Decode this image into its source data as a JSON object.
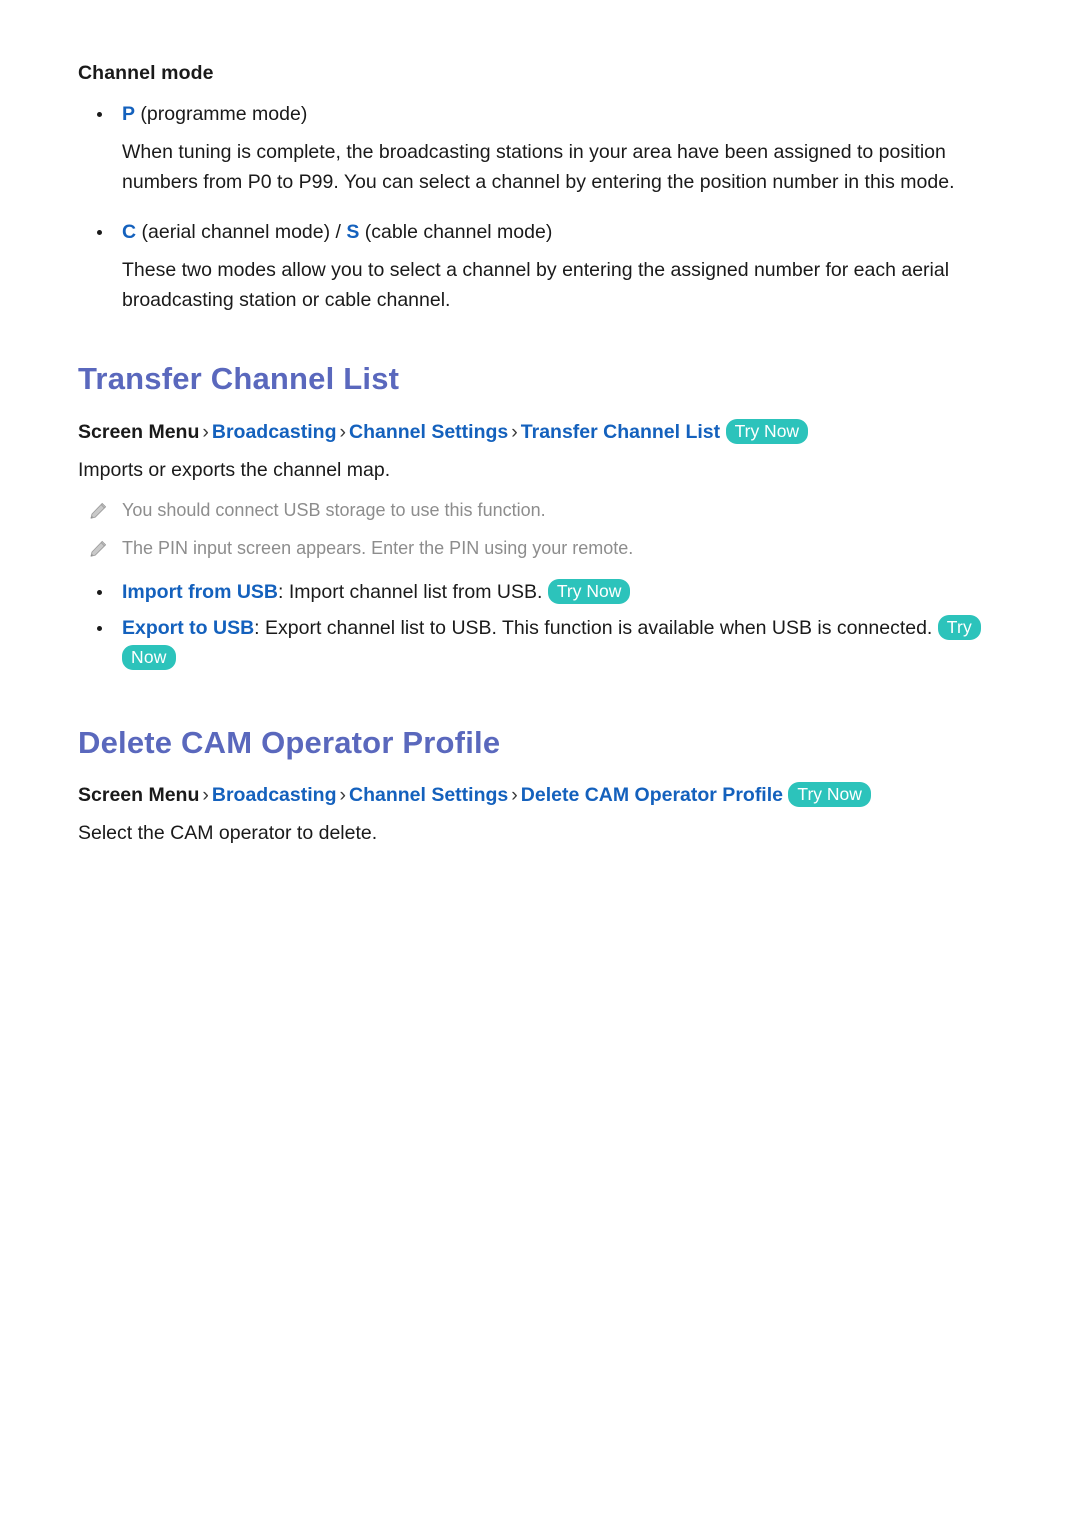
{
  "document": {
    "background_color": "#ffffff",
    "heading_color": "#5a68bd",
    "link_color": "#1461bd",
    "note_color": "#8d8d8d",
    "pill_color": "#2cc3bb",
    "pill_text_color": "#ffffff"
  },
  "channel_mode": {
    "subheading": "Channel mode",
    "items": [
      {
        "accent": "P",
        "label": " (programme mode)",
        "paragraph": "When tuning is complete, the broadcasting stations in your area have been assigned to position numbers from P0 to P99. You can select a channel by entering the position number in this mode."
      },
      {
        "accent": "C",
        "label_mid": " (aerial channel mode) / ",
        "accent2": "S",
        "label_end": " (cable channel mode)",
        "paragraph": "These two modes allow you to select a channel by entering the assigned number for each aerial broadcasting station or cable channel."
      }
    ]
  },
  "transfer_channel_list": {
    "heading": "Transfer Channel List",
    "breadcrumb": {
      "root": "Screen Menu",
      "separator": "›",
      "crumbs": [
        "Broadcasting",
        "Channel Settings",
        "Transfer Channel List"
      ],
      "try_now": "Try Now"
    },
    "description": "Imports or exports the channel map.",
    "notes": [
      "You should connect USB storage to use this function.",
      "The PIN input screen appears. Enter the PIN using your remote."
    ],
    "options": [
      {
        "term": "Import from USB",
        "colon": ": ",
        "text": "Import channel list from USB. ",
        "try_now": "Try Now"
      },
      {
        "term": "Export to USB",
        "colon": ": ",
        "text": "Export channel list to USB. This function is available when USB is connected. ",
        "try_now": "Try Now"
      }
    ]
  },
  "delete_cam_operator_profile": {
    "heading": "Delete CAM Operator Profile",
    "breadcrumb": {
      "root": "Screen Menu",
      "separator": "›",
      "crumbs": [
        "Broadcasting",
        "Channel Settings",
        "Delete CAM Operator Profile"
      ],
      "try_now": "Try Now"
    },
    "description": "Select the CAM operator to delete."
  },
  "icons": {
    "pencil": "pencil-icon",
    "bullet": "bullet-dot"
  }
}
